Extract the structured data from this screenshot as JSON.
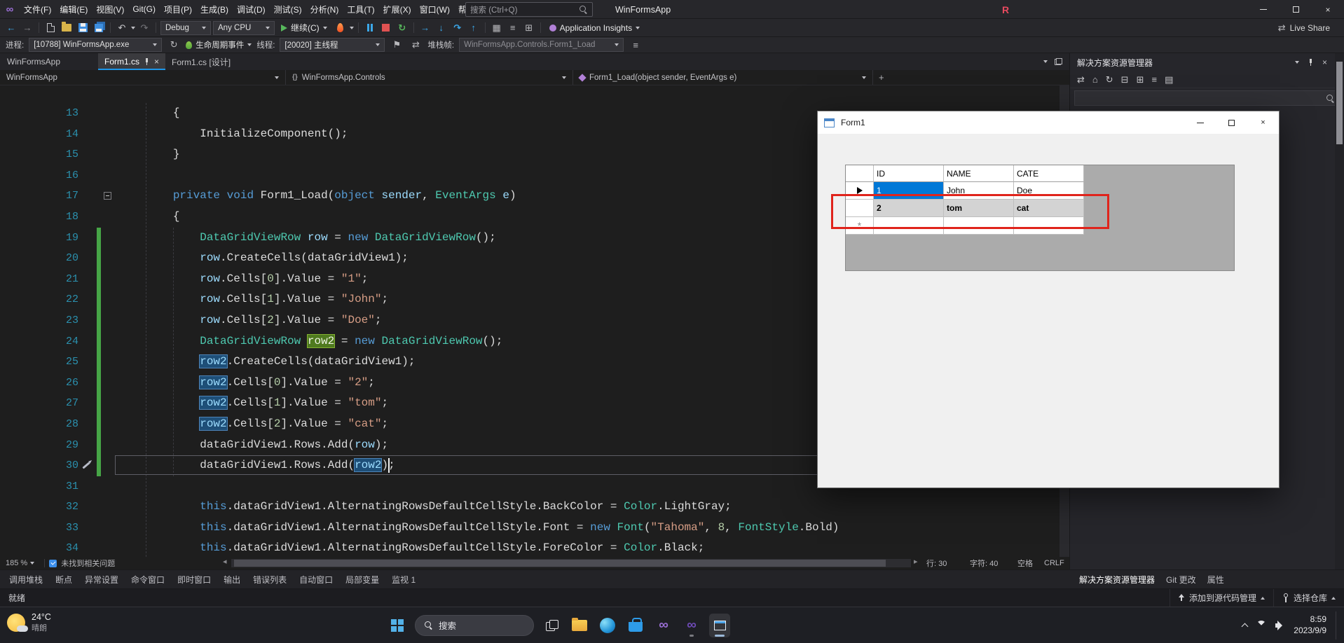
{
  "colors": {
    "accent": "#1C97EA",
    "selection_blue": "#0078D7",
    "annotation_red": "#E0241C",
    "change_bar_green": "#46A546"
  },
  "title_bar": {
    "menu": [
      "文件(F)",
      "编辑(E)",
      "视图(V)",
      "Git(G)",
      "项目(P)",
      "生成(B)",
      "调试(D)",
      "测试(S)",
      "分析(N)",
      "工具(T)",
      "扩展(X)",
      "窗口(W)",
      "帮助(H)"
    ],
    "search_placeholder": "搜索 (Ctrl+Q)",
    "app_title": "WinFormsApp",
    "resharper_badge": "R"
  },
  "toolbar": {
    "config": "Debug",
    "platform": "Any CPU",
    "continue_label": "继续(C)",
    "app_insights_label": "Application Insights",
    "live_share_label": "Live Share"
  },
  "debug_bar": {
    "process_label": "进程:",
    "process_value": "[10788] WinFormsApp.exe",
    "lifecycle_label": "生命周期事件",
    "thread_label": "线程:",
    "thread_value": "[20020] 主线程",
    "frame_label": "堆栈帧:",
    "frame_value": "WinFormsApp.Controls.Form1_Load"
  },
  "tabs": {
    "group_label": "WinFormsApp",
    "items": [
      {
        "label": "Form1.cs",
        "active": true
      },
      {
        "label": "Form1.cs [设计]",
        "active": false
      }
    ]
  },
  "breadcrumb": {
    "project": "WinFormsApp",
    "namespace": "WinFormsApp.Controls",
    "member": "Form1_Load(object sender, EventArgs e)"
  },
  "editor": {
    "lines": [
      {
        "n": 13,
        "t": [
          [
            "        {",
            "pl"
          ]
        ]
      },
      {
        "n": 14,
        "t": [
          [
            "            InitializeComponent();",
            "pl"
          ]
        ]
      },
      {
        "n": 15,
        "t": [
          [
            "        }",
            "pl"
          ]
        ]
      },
      {
        "n": 16,
        "t": []
      },
      {
        "n": 17,
        "fold": true,
        "t": [
          [
            "        ",
            "pl"
          ],
          [
            "private",
            "kw"
          ],
          [
            " ",
            "pl"
          ],
          [
            "void",
            "kw"
          ],
          [
            " Form1_Load(",
            "pl"
          ],
          [
            "object",
            "kw"
          ],
          [
            " ",
            "pl"
          ],
          [
            "sender",
            "lo"
          ],
          [
            ", ",
            "pl"
          ],
          [
            "EventArgs",
            "ty"
          ],
          [
            " ",
            "pl"
          ],
          [
            "e",
            "lo"
          ],
          [
            ")",
            "pl"
          ]
        ]
      },
      {
        "n": 18,
        "t": [
          [
            "        {",
            "pl"
          ]
        ]
      },
      {
        "n": 19,
        "chg": true,
        "t": [
          [
            "            ",
            "pl"
          ],
          [
            "DataGridViewRow",
            "ty"
          ],
          [
            " ",
            "pl"
          ],
          [
            "row",
            "lo"
          ],
          [
            " = ",
            "pl"
          ],
          [
            "new",
            "kw"
          ],
          [
            " ",
            "pl"
          ],
          [
            "DataGridViewRow",
            "ty"
          ],
          [
            "();",
            "pl"
          ]
        ]
      },
      {
        "n": 20,
        "chg": true,
        "t": [
          [
            "            ",
            "pl"
          ],
          [
            "row",
            "lo"
          ],
          [
            ".CreateCells(dataGridView1);",
            "pl"
          ]
        ]
      },
      {
        "n": 21,
        "chg": true,
        "t": [
          [
            "            ",
            "pl"
          ],
          [
            "row",
            "lo"
          ],
          [
            ".Cells[",
            "pl"
          ],
          [
            "0",
            "nu"
          ],
          [
            "].Value = ",
            "pl"
          ],
          [
            "\"1\"",
            "st"
          ],
          [
            ";",
            "pl"
          ]
        ]
      },
      {
        "n": 22,
        "chg": true,
        "t": [
          [
            "            ",
            "pl"
          ],
          [
            "row",
            "lo"
          ],
          [
            ".Cells[",
            "pl"
          ],
          [
            "1",
            "nu"
          ],
          [
            "].Value = ",
            "pl"
          ],
          [
            "\"John\"",
            "st"
          ],
          [
            ";",
            "pl"
          ]
        ]
      },
      {
        "n": 23,
        "chg": true,
        "t": [
          [
            "            ",
            "pl"
          ],
          [
            "row",
            "lo"
          ],
          [
            ".Cells[",
            "pl"
          ],
          [
            "2",
            "nu"
          ],
          [
            "].Value = ",
            "pl"
          ],
          [
            "\"Doe\"",
            "st"
          ],
          [
            ";",
            "pl"
          ]
        ]
      },
      {
        "n": 24,
        "chg": true,
        "t": [
          [
            "            ",
            "pl"
          ],
          [
            "DataGridViewRow",
            "ty"
          ],
          [
            " ",
            "pl"
          ],
          [
            "row2",
            "lo",
            "g"
          ],
          [
            " = ",
            "pl"
          ],
          [
            "new",
            "kw"
          ],
          [
            " ",
            "pl"
          ],
          [
            "DataGridViewRow",
            "ty"
          ],
          [
            "();",
            "pl"
          ]
        ]
      },
      {
        "n": 25,
        "chg": true,
        "t": [
          [
            "            ",
            "pl"
          ],
          [
            "row2",
            "lo",
            "b"
          ],
          [
            ".CreateCells(dataGridView1);",
            "pl"
          ]
        ]
      },
      {
        "n": 26,
        "chg": true,
        "t": [
          [
            "            ",
            "pl"
          ],
          [
            "row2",
            "lo",
            "b"
          ],
          [
            ".Cells[",
            "pl"
          ],
          [
            "0",
            "nu"
          ],
          [
            "].Value = ",
            "pl"
          ],
          [
            "\"2\"",
            "st"
          ],
          [
            ";",
            "pl"
          ]
        ]
      },
      {
        "n": 27,
        "chg": true,
        "t": [
          [
            "            ",
            "pl"
          ],
          [
            "row2",
            "lo",
            "b"
          ],
          [
            ".Cells[",
            "pl"
          ],
          [
            "1",
            "nu"
          ],
          [
            "].Value = ",
            "pl"
          ],
          [
            "\"tom\"",
            "st"
          ],
          [
            ";",
            "pl"
          ]
        ]
      },
      {
        "n": 28,
        "chg": true,
        "t": [
          [
            "            ",
            "pl"
          ],
          [
            "row2",
            "lo",
            "b"
          ],
          [
            ".Cells[",
            "pl"
          ],
          [
            "2",
            "nu"
          ],
          [
            "].Value = ",
            "pl"
          ],
          [
            "\"cat\"",
            "st"
          ],
          [
            ";",
            "pl"
          ]
        ]
      },
      {
        "n": 29,
        "chg": true,
        "t": [
          [
            "            dataGridView1.Rows.Add(",
            "pl"
          ],
          [
            "row",
            "lo"
          ],
          [
            ");",
            "pl"
          ]
        ]
      },
      {
        "n": 30,
        "chg": true,
        "cur": true,
        "pen": true,
        "caret": 40,
        "t": [
          [
            "            dataGridView1.Rows.Add(",
            "pl"
          ],
          [
            "row2",
            "lo",
            "b"
          ],
          [
            ");",
            "pl"
          ]
        ]
      },
      {
        "n": 31,
        "t": []
      },
      {
        "n": 32,
        "t": [
          [
            "            ",
            "pl"
          ],
          [
            "this",
            "kw"
          ],
          [
            ".dataGridView1.AlternatingRowsDefaultCellStyle.BackColor = ",
            "pl"
          ],
          [
            "Color",
            "ty"
          ],
          [
            ".LightGray;",
            "pl"
          ]
        ]
      },
      {
        "n": 33,
        "t": [
          [
            "            ",
            "pl"
          ],
          [
            "this",
            "kw"
          ],
          [
            ".dataGridView1.AlternatingRowsDefaultCellStyle.Font = ",
            "pl"
          ],
          [
            "new",
            "kw"
          ],
          [
            " ",
            "pl"
          ],
          [
            "Font",
            "ty"
          ],
          [
            "(",
            "pl"
          ],
          [
            "\"Tahoma\"",
            "st"
          ],
          [
            ", ",
            "pl"
          ],
          [
            "8",
            "nu"
          ],
          [
            ", ",
            "pl"
          ],
          [
            "FontStyle",
            "ty"
          ],
          [
            ".Bold)",
            "pl"
          ]
        ]
      },
      {
        "n": 34,
        "t": [
          [
            "            ",
            "pl"
          ],
          [
            "this",
            "kw"
          ],
          [
            ".dataGridView1.AlternatingRowsDefaultCellStyle.ForeColor = ",
            "pl"
          ],
          [
            "Color",
            "ty"
          ],
          [
            ".Black;",
            "pl"
          ]
        ]
      }
    ]
  },
  "editor_status": {
    "zoom": "185 %",
    "health": "未找到相关问题",
    "line": "行: 30",
    "column": "字符: 40",
    "spaces": "空格",
    "line_ending": "CRLF"
  },
  "bottom_tabs": [
    "调用堆栈",
    "断点",
    "异常设置",
    "命令窗口",
    "即时窗口",
    "输出",
    "错误列表",
    "自动窗口",
    "局部变量",
    "监视 1"
  ],
  "solution_explorer": {
    "title": "解决方案资源管理器",
    "panel_tabs": [
      "解决方案资源管理器",
      "Git 更改",
      "属性"
    ]
  },
  "status_bar": {
    "ready": "就绪",
    "add_to_source": "添加到源代码管理",
    "select_repo": "选择仓库"
  },
  "form_window": {
    "title": "Form1",
    "grid": {
      "columns": [
        "ID",
        "NAME",
        "CATE"
      ],
      "rows": [
        {
          "cells": [
            "1",
            "John",
            "Doe"
          ],
          "selected_cell": 0,
          "current": true,
          "alt": false
        },
        {
          "cells": [
            "2",
            "tom",
            "cat"
          ],
          "alt": true
        },
        {
          "cells": [
            "",
            "",
            ""
          ],
          "new_row": true,
          "alt": false
        }
      ]
    }
  },
  "taskbar": {
    "weather_temp": "24°C",
    "weather_desc": "晴朗",
    "search_label": "搜索",
    "time": "8:59",
    "date": "2023/9/9"
  }
}
